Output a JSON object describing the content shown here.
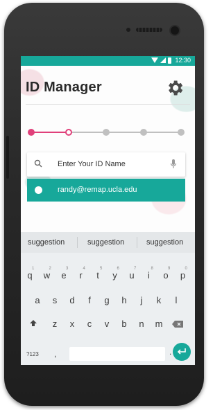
{
  "status_bar": {
    "time": "12:30"
  },
  "app": {
    "title": "ID Manager",
    "progress": {
      "current_step": 2,
      "total_steps": 5
    }
  },
  "search": {
    "placeholder": "Enter Your ID Name"
  },
  "result": {
    "email": "randy@remap.ucla.edu"
  },
  "keyboard": {
    "suggestions": [
      "suggestion",
      "suggestion",
      "suggestion"
    ],
    "row1": [
      "q",
      "w",
      "e",
      "r",
      "t",
      "y",
      "u",
      "i",
      "o",
      "p"
    ],
    "row1_hints": [
      "1",
      "2",
      "3",
      "4",
      "5",
      "6",
      "7",
      "8",
      "9",
      "0"
    ],
    "row2": [
      "a",
      "s",
      "d",
      "f",
      "g",
      "h",
      "j",
      "k",
      "l"
    ],
    "row3": [
      "z",
      "x",
      "c",
      "v",
      "b",
      "n",
      "m"
    ],
    "symbols_key": "?123",
    "comma": ",",
    "period": "."
  },
  "colors": {
    "accent": "#17a89a",
    "progress_active": "#e0407a",
    "progress_inactive": "#c0c0c0"
  },
  "icons": {
    "settings": "gear-icon",
    "search": "search-icon",
    "mic": "mic-icon",
    "shift": "shift-icon",
    "backspace": "backspace-icon",
    "enter": "enter-icon"
  }
}
